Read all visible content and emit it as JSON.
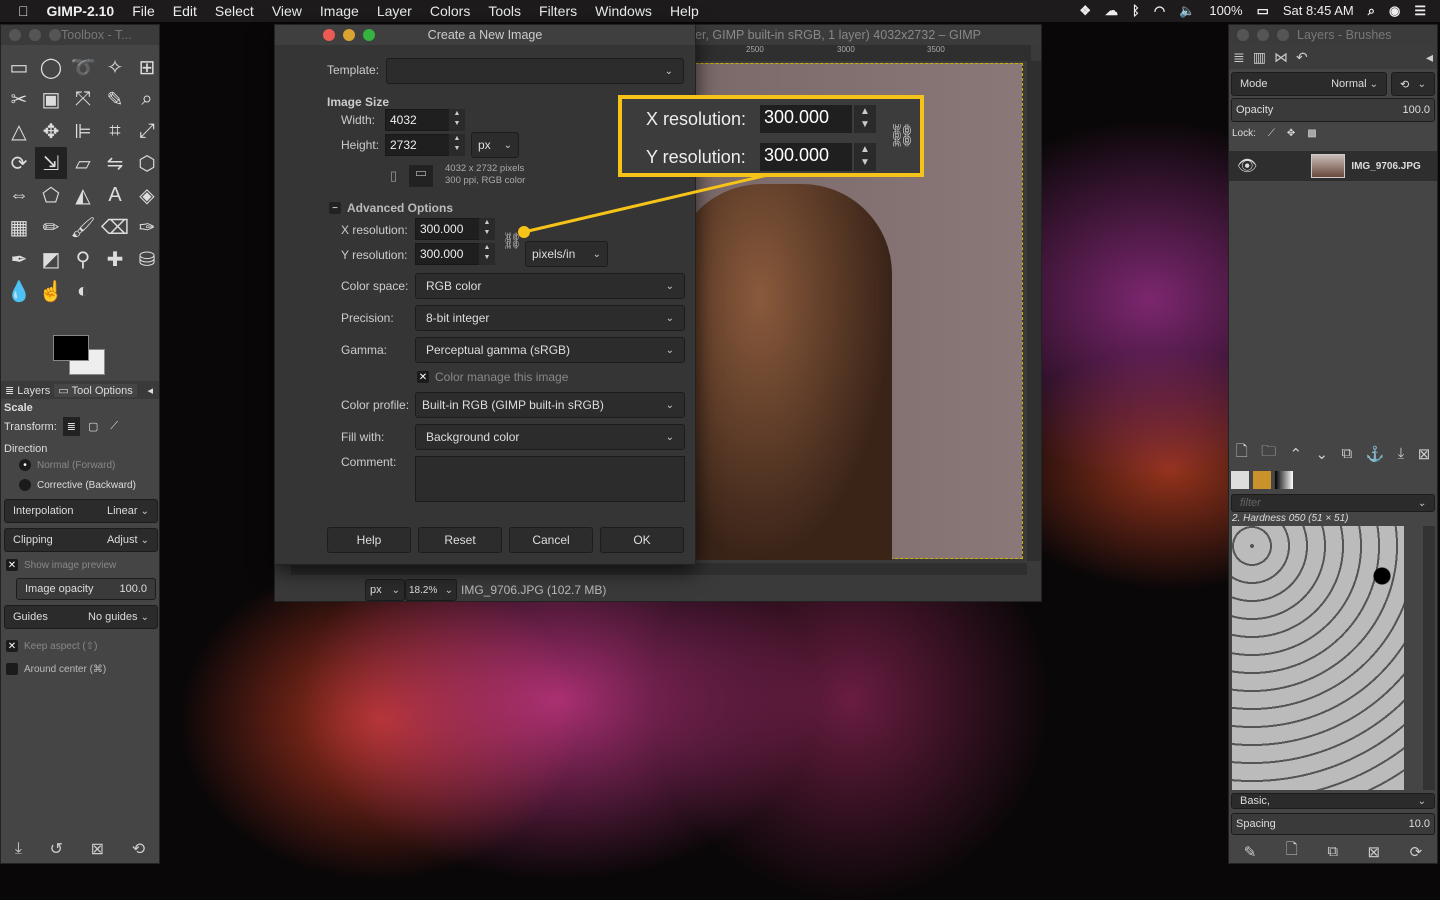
{
  "menubar": {
    "app": "GIMP-2.10",
    "items": [
      "File",
      "Edit",
      "Select",
      "View",
      "Image",
      "Layer",
      "Colors",
      "Tools",
      "Filters",
      "Windows",
      "Help"
    ],
    "battery": "100%",
    "clock": "Sat 8:45 AM"
  },
  "toolbox": {
    "title": "Toolbox - T...",
    "tabs": [
      "Layers",
      "Tool Options"
    ],
    "tool_name": "Scale",
    "transform_label": "Transform:",
    "direction_label": "Direction",
    "direction_options": [
      "Normal (Forward)",
      "Corrective (Backward)"
    ],
    "interpolation": {
      "label": "Interpolation",
      "value": "Linear"
    },
    "clipping": {
      "label": "Clipping",
      "value": "Adjust"
    },
    "show_preview": "Show image preview",
    "image_opacity": {
      "label": "Image opacity",
      "value": "100.0"
    },
    "guides": {
      "label": "Guides",
      "value": "No guides"
    },
    "keep_aspect": "Keep aspect (⇧)",
    "around_center": "Around center (⌘)"
  },
  "image_window": {
    "title": "er, GIMP built-in sRGB, 1 layer) 4032x2732 – GIMP",
    "ruler_ticks": [
      "2500",
      "3000",
      "3500"
    ],
    "unit": "px",
    "zoom": "18.2%",
    "status": "IMG_9706.JPG (102.7 MB)"
  },
  "dialog": {
    "title": "Create a New Image",
    "template_label": "Template:",
    "template_value": "",
    "image_size": "Image Size",
    "width_label": "Width:",
    "width": "4032",
    "height_label": "Height:",
    "height": "2732",
    "size_unit": "px",
    "info_line1": "4032 x 2732 pixels",
    "info_line2": "300 ppi, RGB color",
    "advanced": "Advanced Options",
    "xres_label": "X resolution:",
    "xres": "300.000",
    "yres_label": "Y resolution:",
    "yres": "300.000",
    "res_unit": "pixels/in",
    "color_space_label": "Color space:",
    "color_space": "RGB color",
    "precision_label": "Precision:",
    "precision": "8-bit integer",
    "gamma_label": "Gamma:",
    "gamma": "Perceptual gamma (sRGB)",
    "color_manage": "Color manage this image",
    "color_profile_label": "Color profile:",
    "color_profile": "Built-in RGB (GIMP built-in sRGB)",
    "fill_label": "Fill with:",
    "fill": "Background color",
    "comment_label": "Comment:",
    "comment": "",
    "buttons": {
      "help": "Help",
      "reset": "Reset",
      "cancel": "Cancel",
      "ok": "OK"
    }
  },
  "callout": {
    "xres_label": "X resolution:",
    "xres": "300.000",
    "yres_label": "Y resolution:",
    "yres": "300.000",
    "color": "#f6c419"
  },
  "layers": {
    "title": "Layers - Brushes",
    "mode_label": "Mode",
    "mode": "Normal",
    "opacity_label": "Opacity",
    "opacity": "100.0",
    "lock_label": "Lock:",
    "layer_name": "IMG_9706.JPG",
    "filter_placeholder": "filter",
    "brush_name": "2. Hardness 050 (51 × 51)",
    "brush_tag": "Basic,",
    "spacing_label": "Spacing",
    "spacing": "10.0"
  }
}
